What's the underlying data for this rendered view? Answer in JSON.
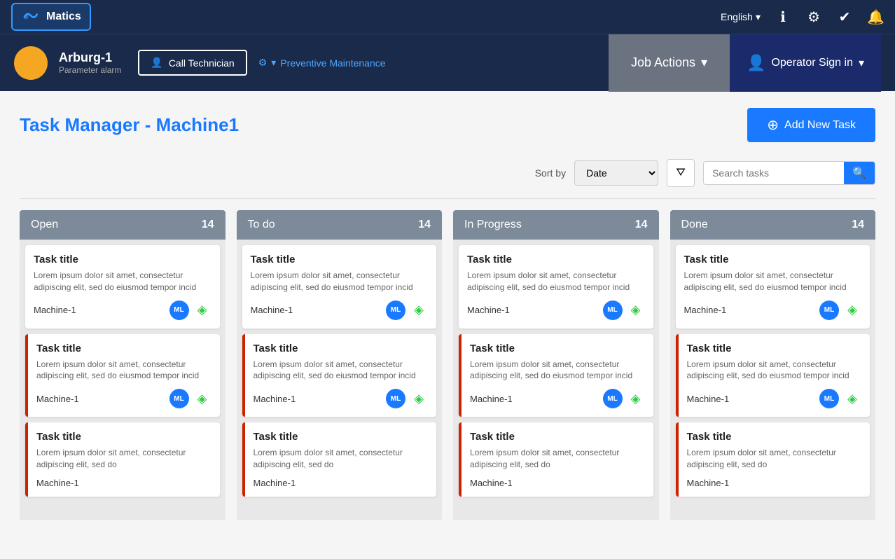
{
  "app": {
    "logo_text": "Matics",
    "lang_label": "English",
    "lang_dropdown": "▾"
  },
  "nav_icons": {
    "info": "ℹ",
    "gear": "⚙",
    "checklist": "✔",
    "bell": "🔔"
  },
  "machine": {
    "name": "Arburg-1",
    "sub": "Parameter alarm",
    "call_tech_label": "Call Technician",
    "maintenance_label": "Preventive Maintenance",
    "job_actions_label": "Job Actions",
    "operator_label": "Operator Sign in"
  },
  "page": {
    "title": "Task Manager - Machine1",
    "add_task_label": "Add New Task",
    "sort_label": "Sort by",
    "sort_default": "Date",
    "search_placeholder": "Search tasks"
  },
  "columns": [
    {
      "id": "open",
      "title": "Open",
      "count": "14"
    },
    {
      "id": "todo",
      "title": "To do",
      "count": "14"
    },
    {
      "id": "inprogress",
      "title": "In Progress",
      "count": "14"
    },
    {
      "id": "done",
      "title": "Done",
      "count": "14"
    }
  ],
  "task_template": {
    "title": "Task title",
    "desc": "Lorem ipsum dolor sit amet, consectetur adipiscing elit, sed do eiusmod tempor incid",
    "machine": "Machine-1",
    "avatar": "ML"
  }
}
